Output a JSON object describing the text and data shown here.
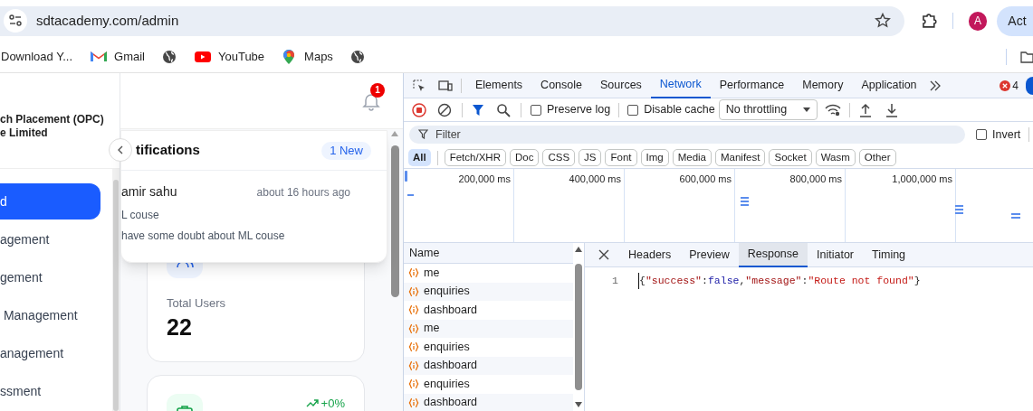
{
  "browser": {
    "url": "sdtacademy.com/admin",
    "profile_initial": "A",
    "action_button": "Act",
    "bookmarks": [
      {
        "label": "Download Y..."
      },
      {
        "label": "Gmail",
        "kind": "mail"
      },
      {
        "kind": "globe"
      },
      {
        "label": "YouTube",
        "kind": "video"
      },
      {
        "label": "Maps",
        "kind": "map"
      },
      {
        "kind": "globe"
      }
    ]
  },
  "page": {
    "sidebar": {
      "org_lines": [
        "ch Placement (OPC)",
        "e Limited"
      ],
      "items": [
        {
          "label": "d",
          "selected": true
        },
        {
          "label": "agement",
          "selected": false
        },
        {
          "label": "gement",
          "selected": false
        },
        {
          "label": " Management",
          "selected": false
        },
        {
          "label": "anagement",
          "selected": false
        },
        {
          "label": "ssment",
          "selected": false
        }
      ]
    },
    "notification_count": "1",
    "notifications": {
      "title": "tifications",
      "badge": "1 New",
      "items": [
        {
          "name": "amir sahu",
          "time": "about 16 hours ago",
          "subject": "L couse",
          "message": "have some doubt about ML couse"
        }
      ]
    },
    "cards": [
      {
        "kind": "users",
        "label": "Total Users",
        "value": "22"
      },
      {
        "kind": "jobs",
        "change": "+0%"
      }
    ]
  },
  "devtools": {
    "tabs": [
      {
        "label": "Elements",
        "selected": false
      },
      {
        "label": "Console",
        "selected": false
      },
      {
        "label": "Sources",
        "selected": false
      },
      {
        "label": "Network",
        "selected": true
      },
      {
        "label": "Performance",
        "selected": false
      },
      {
        "label": "Memory",
        "selected": false
      },
      {
        "label": "Application",
        "selected": false
      }
    ],
    "error_count": "4",
    "preserve_log": {
      "label": "Preserve log",
      "checked": false
    },
    "disable_cache": {
      "label": "Disable cache",
      "checked": false
    },
    "throttling": "No throttling",
    "filter": {
      "placeholder": "Filter"
    },
    "invert": {
      "label": "Invert",
      "checked": false
    },
    "type_filters": [
      {
        "label": "All",
        "selected": true
      },
      {
        "label": "Fetch/XHR",
        "selected": false
      },
      {
        "label": "Doc",
        "selected": false
      },
      {
        "label": "CSS",
        "selected": false
      },
      {
        "label": "JS",
        "selected": false
      },
      {
        "label": "Font",
        "selected": false
      },
      {
        "label": "Img",
        "selected": false
      },
      {
        "label": "Media",
        "selected": false
      },
      {
        "label": "Manifest",
        "selected": false
      },
      {
        "label": "Socket",
        "selected": false
      },
      {
        "label": "Wasm",
        "selected": false
      },
      {
        "label": "Other",
        "selected": false
      }
    ],
    "timeline_ticks": [
      "200,000 ms",
      "400,000 ms",
      "600,000 ms",
      "800,000 ms",
      "1,000,000 ms"
    ],
    "name_column": "Name",
    "requests": [
      {
        "name": "me"
      },
      {
        "name": "enquiries"
      },
      {
        "name": "dashboard"
      },
      {
        "name": "me"
      },
      {
        "name": "enquiries"
      },
      {
        "name": "dashboard"
      },
      {
        "name": "enquiries"
      },
      {
        "name": "dashboard"
      }
    ],
    "detail_tabs": [
      {
        "label": "Headers",
        "selected": false
      },
      {
        "label": "Preview",
        "selected": false
      },
      {
        "label": "Response",
        "selected": true
      },
      {
        "label": "Initiator",
        "selected": false
      },
      {
        "label": "Timing",
        "selected": false
      }
    ],
    "response_lines": [
      {
        "number": "1",
        "tokens": [
          {
            "text": "{",
            "kind": "punct"
          },
          {
            "text": "\"success\"",
            "kind": "key"
          },
          {
            "text": ":",
            "kind": "punct"
          },
          {
            "text": "false",
            "kind": "literal"
          },
          {
            "text": ",",
            "kind": "punct"
          },
          {
            "text": "\"message\"",
            "kind": "key"
          },
          {
            "text": ":",
            "kind": "punct"
          },
          {
            "text": "\"Route not found\"",
            "kind": "string"
          },
          {
            "text": "}",
            "kind": "punct"
          }
        ]
      }
    ]
  }
}
